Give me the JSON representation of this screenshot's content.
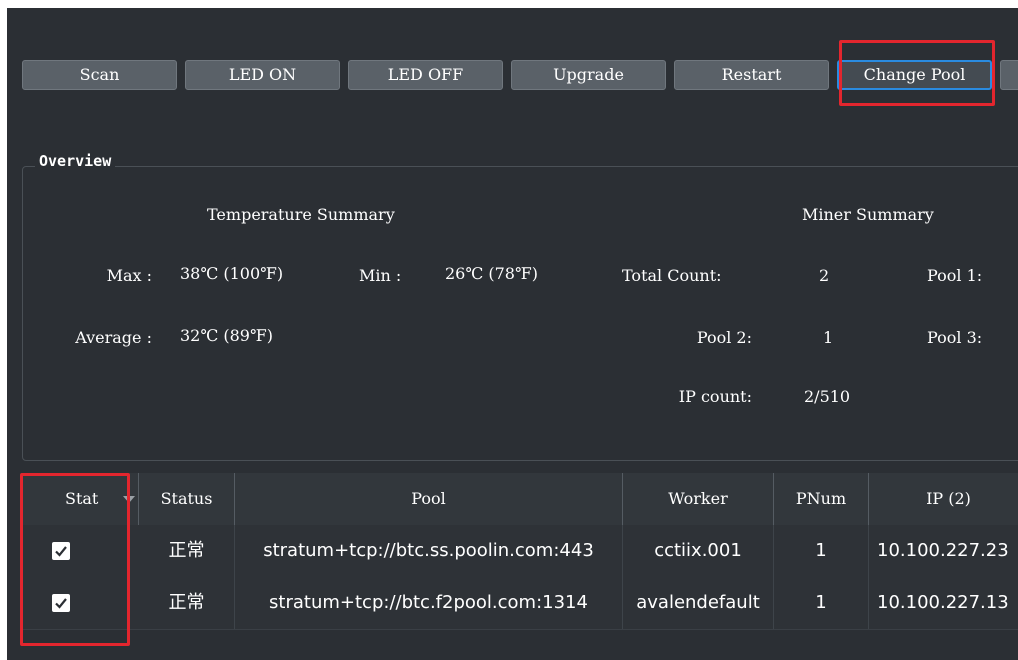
{
  "toolbar": {
    "buttons": [
      {
        "label": "Scan"
      },
      {
        "label": "LED ON"
      },
      {
        "label": "LED OFF"
      },
      {
        "label": "Upgrade"
      },
      {
        "label": "Restart"
      },
      {
        "label": "Change Pool"
      }
    ]
  },
  "overview": {
    "title": "Overview",
    "temperature": {
      "heading": "Temperature Summary",
      "max_label": "Max :",
      "max_value": "38℃ (100℉)",
      "min_label": "Min :",
      "min_value": "26℃ (78℉)",
      "avg_label": "Average :",
      "avg_value": "32℃ (89℉)"
    },
    "miner": {
      "heading": "Miner Summary",
      "total_label": "Total Count:",
      "total_value": "2",
      "pool1_label": "Pool 1:",
      "pool2_label": "Pool 2:",
      "pool2_value": "1",
      "pool3_label": "Pool 3:",
      "ip_label": "IP count:",
      "ip_value": "2/510"
    }
  },
  "table": {
    "headers": [
      "Stat",
      "Status",
      "Pool",
      "Worker",
      "PNum",
      "IP (2)"
    ],
    "rows": [
      {
        "checked": true,
        "status": "正常",
        "pool": "stratum+tcp://btc.ss.poolin.com:443",
        "worker": "cctiix.001",
        "pnum": "1",
        "ip": "10.100.227.23"
      },
      {
        "checked": true,
        "status": "正常",
        "pool": "stratum+tcp://btc.f2pool.com:1314",
        "worker": "avalendefault",
        "pnum": "1",
        "ip": "10.100.227.13"
      }
    ]
  },
  "colors": {
    "background": "#2b2f34",
    "button": "#5a6168",
    "active_border": "#2a8be0",
    "highlight": "#e3262e"
  }
}
